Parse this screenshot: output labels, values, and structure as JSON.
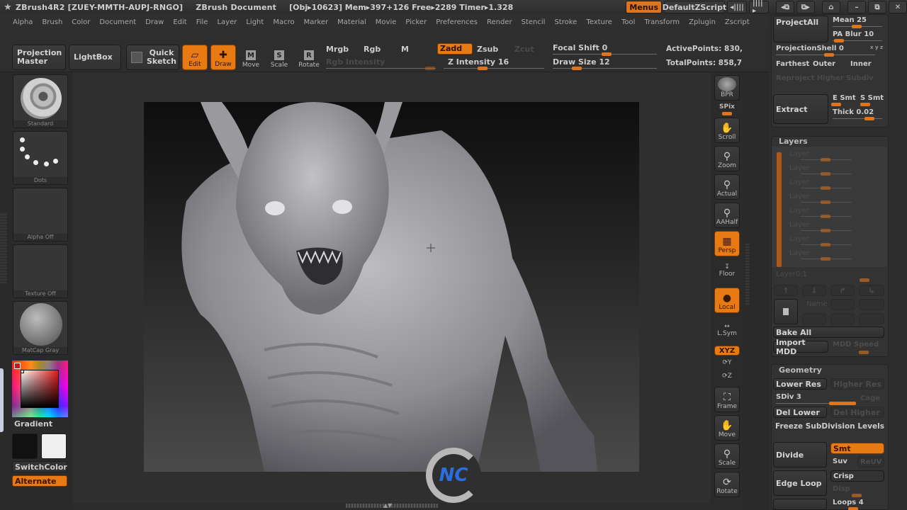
{
  "titlebar": {
    "app": "ZBrush4R2 [ZUEY-MMTH-AUPJ-RNGO]",
    "document": "ZBrush Document",
    "stats": "[Obj▸10623] Mem▸397+126 Free▸2289 Timer▸1.328",
    "buttons": {
      "menus": "Menus",
      "script": "DefaultZScript"
    },
    "icons": [
      "scroll-left-icon",
      "scroll-right-icon",
      "layout-prev-icon",
      "layout-next-icon",
      "lock-icon",
      "minimize-icon",
      "restore-icon",
      "close-icon"
    ],
    "glyphs": {
      "scroll_left": "◂||||",
      "scroll_right": "||||▸",
      "layout_prev": "◂⧉",
      "layout_next": "⧉▸",
      "lock": "⌂",
      "minimize": "–",
      "restore": "⧉",
      "close": "✕"
    }
  },
  "menubar": [
    "Alpha",
    "Brush",
    "Color",
    "Document",
    "Draw",
    "Edit",
    "File",
    "Layer",
    "Light",
    "Macro",
    "Marker",
    "Material",
    "Movie",
    "Picker",
    "Preferences",
    "Render",
    "Stencil",
    "Stroke",
    "Texture",
    "Tool",
    "Transform",
    "Zplugin",
    "Zscript"
  ],
  "toolbar": {
    "projection_master": [
      "Projection",
      "Master"
    ],
    "lightbox": "LightBox",
    "quick_sketch": [
      "Quick",
      "Sketch"
    ],
    "edit": "Edit",
    "draw": "Draw",
    "move": "Move",
    "scale": "Scale",
    "rotate": "Rotate",
    "move_key": "M",
    "scale_key": "S",
    "rotate_key": "R",
    "mrgb": "Mrgb",
    "rgb": "Rgb",
    "m": "M",
    "rgb_intensity": "Rgb Intensity",
    "zadd": "Zadd",
    "zsub": "Zsub",
    "zcut": "Zcut",
    "z_intensity": "Z Intensity 16",
    "focal_shift": "Focal Shift 0",
    "draw_size": "Draw Size 12",
    "active_points": "ActivePoints: 830,",
    "total_points": "TotalPoints: 858,7",
    "values": {
      "z_intensity": 16,
      "focal_shift": 0,
      "draw_size": 12
    }
  },
  "leftshelf": {
    "brush": "Standard",
    "stroke": "Dots",
    "alpha": "Alpha Off",
    "texture": "Texture Off",
    "material": "MatCap Gray",
    "gradient": "Gradient",
    "switch_color": "SwitchColor",
    "alternate": "Alternate",
    "colors": {
      "main": "#111111",
      "secondary": "#f0f0f0",
      "picked": "#c41a1a"
    }
  },
  "rightshelf": {
    "bpr": "BPR",
    "spix": "SPix",
    "scroll": "Scroll",
    "zoom": "Zoom",
    "actual": "Actual",
    "aahalf": "AAHalf",
    "persp": "Persp",
    "floor": "Floor",
    "local": "Local",
    "lsym": "L.Sym",
    "xyz": "XYZ",
    "y": "Y",
    "z": "Z",
    "frame": "Frame",
    "move": "Move",
    "scale": "Scale",
    "rotate": "Rotate"
  },
  "rpanel": {
    "projection": {
      "project_all": "ProjectAll",
      "mean": "Mean 25",
      "pa_blur": "PA Blur 10",
      "projection_shell": "ProjectionShell 0",
      "xyz": "x y z",
      "farthest": "Farthest",
      "outer": "Outer",
      "inner": "Inner",
      "reproject": "Reproject Higher Subdiv",
      "extract": "Extract",
      "e_smt": "E Smt",
      "s_smt": "S Smt",
      "thick": "Thick 0.02"
    },
    "layers": {
      "title": "Layers",
      "rows": [
        "Layer",
        "Layer",
        "Layer",
        "Layer",
        "Layer",
        "Layer",
        "Layer",
        "Layer"
      ],
      "current": "Layer0:1",
      "name": "Name",
      "bake_all": "Bake All",
      "import_mdd": "Import MDD",
      "mdd_speed": "MDD Speed"
    },
    "geometry": {
      "title": "Geometry",
      "lower_res": "Lower Res",
      "higher_res": "Higher Res",
      "sdiv": "SDiv 3",
      "cage": "Cage",
      "del_lower": "Del Lower",
      "del_higher": "Del Higher",
      "freeze": "Freeze SubDivision Levels",
      "divide": "Divide",
      "smt": "Smt",
      "suv": "Suv",
      "reuv": "ReUV",
      "edge_loop": "Edge Loop",
      "crisp": "Crisp",
      "disp": "Disp",
      "loops": "Loops 4"
    }
  },
  "watermark": "NC"
}
